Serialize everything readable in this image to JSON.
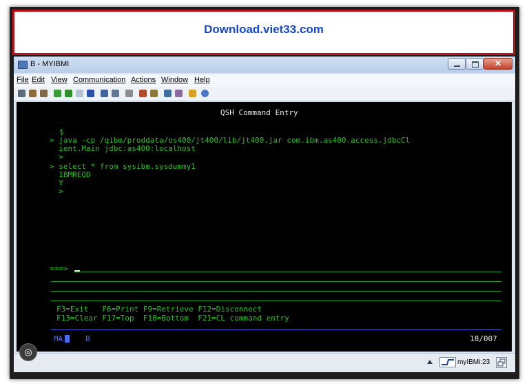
{
  "banner": {
    "link_text": "Download.viet33.com"
  },
  "window": {
    "title": "B - MYIBMI",
    "close_glyph": "✕"
  },
  "menu": [
    "File",
    "Edit",
    "View",
    "Communication",
    "Actions",
    "Window",
    "Help"
  ],
  "toolbar": {
    "icons": [
      "print-icon",
      "copy-icon",
      "paste-icon",
      "send-icon",
      "receive-icon",
      "macro-icon",
      "display-icon",
      "keyboard-icon",
      "color-icon",
      "tools-icon",
      "transfer-icon",
      "upload-icon",
      "download-icon",
      "notes-icon",
      "help-icon"
    ]
  },
  "terminal": {
    "title": "QSH Command Entry",
    "lines": [
      "$",
      "> java -cp /qibm/proddata/os400/jt400/lib/jt400.jar com.ibm.as400.access.jdbcCl",
      "  ient.Main jdbc:as400:localhost",
      "  >",
      "> select * from sysibm.sysdummy1",
      "  IBMREQD",
      "  Y",
      "  >"
    ],
    "prompt": "===>",
    "function_keys_1": "F3=Exit   F6=Print F9=Retrieve F12=Disconnect",
    "function_keys_2": "F13=Clear F17=Top  F18=Bottom  F21=CL command entry",
    "status_left": "MA",
    "status_mid": "B",
    "status_right": "18/007"
  },
  "statusbar": {
    "session": "myIBMi:23"
  },
  "colors": {
    "terminal_text": "#23c61a",
    "terminal_bg": "#000000",
    "banner_border": "#c0101a",
    "banner_text": "#1447d6"
  }
}
